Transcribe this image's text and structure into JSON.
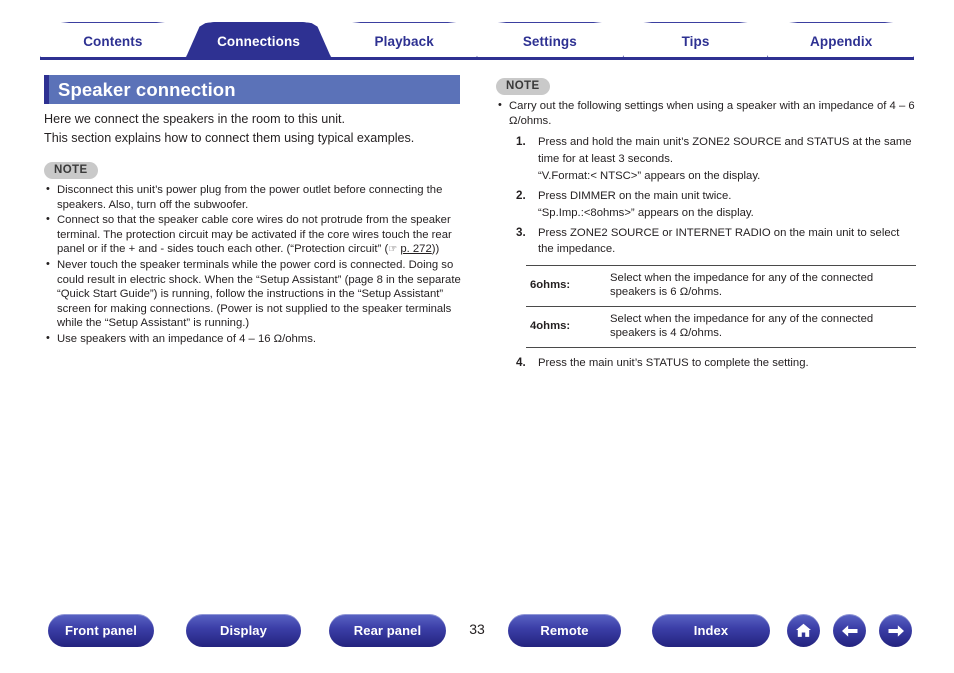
{
  "tabs": [
    {
      "label": "Contents",
      "active": false
    },
    {
      "label": "Connections",
      "active": true
    },
    {
      "label": "Playback",
      "active": false
    },
    {
      "label": "Settings",
      "active": false
    },
    {
      "label": "Tips",
      "active": false
    },
    {
      "label": "Appendix",
      "active": false
    }
  ],
  "section": {
    "title": "Speaker connection",
    "bar_color": "#5b72b8",
    "accent_color": "#2e3192"
  },
  "left_column": {
    "intro_line_1": "Here we connect the speakers in the room to this unit.",
    "intro_line_2": "This section explains how to connect them using typical examples.",
    "note_label": "NOTE",
    "notes": [
      "Disconnect this unit’s power plug from the power outlet before connecting the speakers. Also, turn off the subwoofer.",
      "Connect so that the speaker cable core wires do not protrude from the speaker terminal. The protection circuit may be activated if the core wires touch the rear panel or if the + and - sides touch each other. (“Protection circuit” (",
      "Never touch the speaker terminals while the power cord is connected. Doing so could result in electric shock. When the “Setup Assistant” (page 8 in the separate “Quick Start Guide”) is running, follow the instructions in the “Setup Assistant” screen for making connections. (Power is not supplied to the speaker terminals while the “Setup Assistant” is running.)",
      "Use speakers with an impedance of 4 – 16 Ω/ohms."
    ],
    "xref_link": "p. 272",
    "xref_suffix": "))"
  },
  "right_column": {
    "note_label": "NOTE",
    "note_bullet": "Carry out the following settings when using a speaker with an impedance of 4 – 6 Ω/ohms.",
    "steps": [
      {
        "number": "1.",
        "text": "Press and hold the main unit’s ZONE2 SOURCE and STATUS at the same time for at least 3 seconds.",
        "sub": "“V.Format:< NTSC>” appears on the display."
      },
      {
        "number": "2.",
        "text": "Press DIMMER on the main unit twice.",
        "sub": "“Sp.Imp.:<8ohms>” appears on the display."
      },
      {
        "number": "3.",
        "text": "Press ZONE2 SOURCE or INTERNET RADIO on the main unit to select the impedance.",
        "sub": ""
      },
      {
        "number": "4.",
        "text": "Press the main unit’s STATUS to complete the setting.",
        "sub": ""
      }
    ],
    "table": {
      "rows": [
        {
          "key": "6ohms:",
          "value": "Select when the impedance for any of the connected speakers is 6 Ω/ohms."
        },
        {
          "key": "4ohms:",
          "value": "Select when the impedance for any of the connected speakers is 4 Ω/ohms."
        }
      ]
    }
  },
  "bottom_nav": {
    "buttons": [
      {
        "label": "Front panel"
      },
      {
        "label": "Display"
      },
      {
        "label": "Rear panel"
      },
      {
        "label": "Remote"
      },
      {
        "label": "Index"
      }
    ],
    "page_number": "33",
    "icons": [
      "home-icon",
      "arrow-left-icon",
      "arrow-right-icon"
    ]
  }
}
